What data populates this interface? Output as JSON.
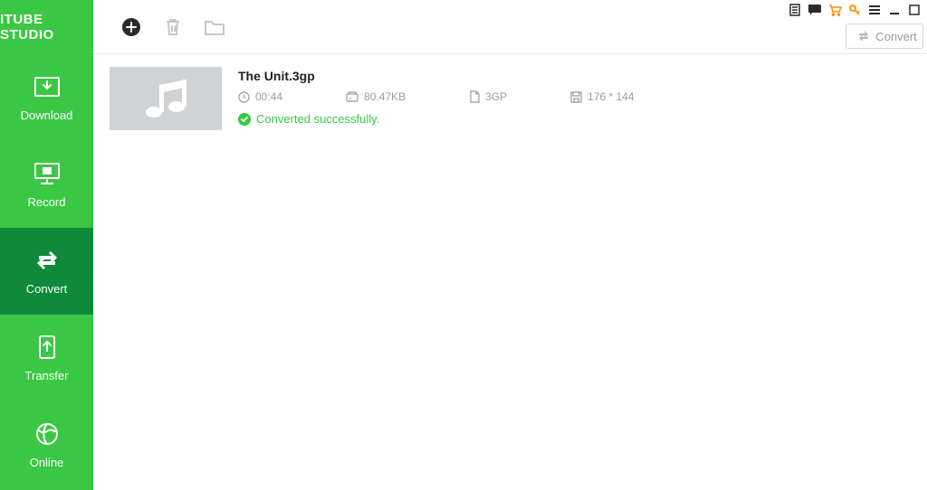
{
  "brand": "ITUBE STUDIO",
  "sidebar": {
    "items": [
      {
        "label": "Download"
      },
      {
        "label": "Record"
      },
      {
        "label": "Convert"
      },
      {
        "label": "Transfer"
      },
      {
        "label": "Online"
      }
    ]
  },
  "toolbar": {
    "convert_label": "Convert"
  },
  "file": {
    "name": "The Unit.3gp",
    "duration": "00:44",
    "size": "80.47KB",
    "format": "3GP",
    "resolution": "176 * 144",
    "status": "Converted successfully."
  }
}
